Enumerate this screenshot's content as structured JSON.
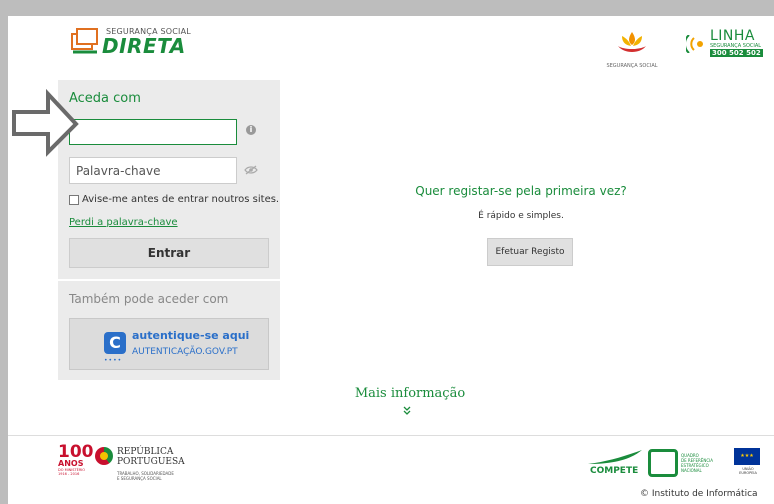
{
  "header": {
    "logo_top": "SEGURANÇA SOCIAL",
    "logo_main": "DIRETA",
    "ss_label": "SEGURANÇA SOCIAL",
    "linha_big": "LINHA",
    "linha_small": "SEGURANÇA SOCIAL",
    "linha_number": "300 502 502"
  },
  "login": {
    "title": "Aceda com",
    "username_value": "",
    "password_placeholder": "Palavra-chave",
    "remember_label": "Avise-me antes de entrar noutros sites.",
    "forgot_link": "Perdi a palavra-chave",
    "enter_button": "Entrar",
    "also_label": "Também pode aceder com",
    "auth_line1": "autentique-se aqui",
    "auth_line2": "AUTENTICAÇÃO.GOV.PT"
  },
  "register": {
    "title": "Quer registar-se pela primeira vez?",
    "subtitle": "É rápido e simples.",
    "button": "Efetuar Registo"
  },
  "more_info": {
    "label": "Mais informação",
    "chevron": "»"
  },
  "footer": {
    "centenary_number": "100",
    "centenary_anos": "ANOS",
    "centenary_small_1": "DO MINISTÉRIO",
    "centenary_small_2": "1916 - 2016",
    "republic_1": "REPÚBLICA",
    "republic_2": "PORTUGUESA",
    "republic_3": "TRABALHO, SOLIDARIEDADE",
    "republic_4": "E SEGURANÇA SOCIAL",
    "compete": "COMPETE",
    "qren_1": "QUADRO",
    "qren_2": "DE REFERÊNCIA",
    "qren_3": "ESTRATÉGICO",
    "qren_4": "NACIONAL",
    "eu_label": "UNIÃO EUROPEIA",
    "copyright": "© Instituto de Informática"
  },
  "colors": {
    "brand_green": "#1a8c3c",
    "panel_gray": "#ebebeb",
    "auth_blue": "#2a6fc9"
  }
}
